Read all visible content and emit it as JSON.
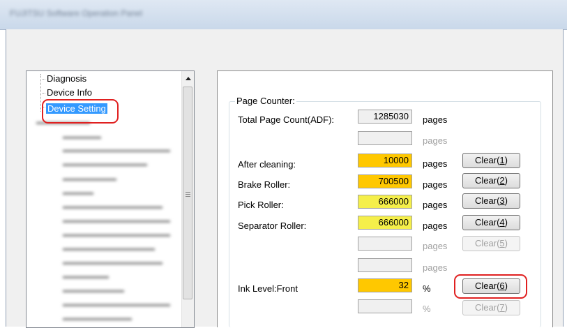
{
  "window": {
    "title": "FUJITSU Software Operation Panel"
  },
  "tree": {
    "items": [
      {
        "label": "Diagnosis",
        "selected": false
      },
      {
        "label": "Device Info",
        "selected": false
      },
      {
        "label": "Device Setting",
        "selected": true
      }
    ]
  },
  "page_counter": {
    "group_title": "Page Counter:",
    "rows": [
      {
        "label": "Total Page Count(ADF):",
        "value": "1285030",
        "unit": "pages",
        "unit_enabled": true,
        "field_color": "plain",
        "button": null
      },
      {
        "label": "",
        "value": "",
        "unit": "pages",
        "unit_enabled": false,
        "field_color": "plain",
        "button": null
      },
      {
        "label": "After cleaning:",
        "value": "10000",
        "unit": "pages",
        "unit_enabled": true,
        "field_color": "orange",
        "button": {
          "label": "Clear",
          "key": "1",
          "enabled": true
        }
      },
      {
        "label": "Brake Roller:",
        "value": "700500",
        "unit": "pages",
        "unit_enabled": true,
        "field_color": "orange",
        "button": {
          "label": "Clear",
          "key": "2",
          "enabled": true
        }
      },
      {
        "label": "Pick Roller:",
        "value": "666000",
        "unit": "pages",
        "unit_enabled": true,
        "field_color": "yellow",
        "button": {
          "label": "Clear",
          "key": "3",
          "enabled": true
        }
      },
      {
        "label": "Separator Roller:",
        "value": "666000",
        "unit": "pages",
        "unit_enabled": true,
        "field_color": "yellow",
        "button": {
          "label": "Clear",
          "key": "4",
          "enabled": true
        }
      },
      {
        "label": "",
        "value": "",
        "unit": "pages",
        "unit_enabled": false,
        "field_color": "plain",
        "button": {
          "label": "Clear",
          "key": "5",
          "enabled": false
        }
      },
      {
        "label": "",
        "value": "",
        "unit": "pages",
        "unit_enabled": false,
        "field_color": "plain",
        "button": null
      },
      {
        "label": "Ink Level:Front",
        "value": "32",
        "unit": "%",
        "unit_enabled": true,
        "field_color": "orange",
        "button": {
          "label": "Clear",
          "key": "6",
          "enabled": true
        }
      },
      {
        "label": "",
        "value": "",
        "unit": "%",
        "unit_enabled": false,
        "field_color": "plain",
        "button": {
          "label": "Clear",
          "key": "7",
          "enabled": false
        }
      }
    ]
  },
  "colors": {
    "field_orange": "#ffc800",
    "field_yellow": "#f5ef4a",
    "selection": "#3399ff",
    "highlight_ring": "#e02020"
  }
}
